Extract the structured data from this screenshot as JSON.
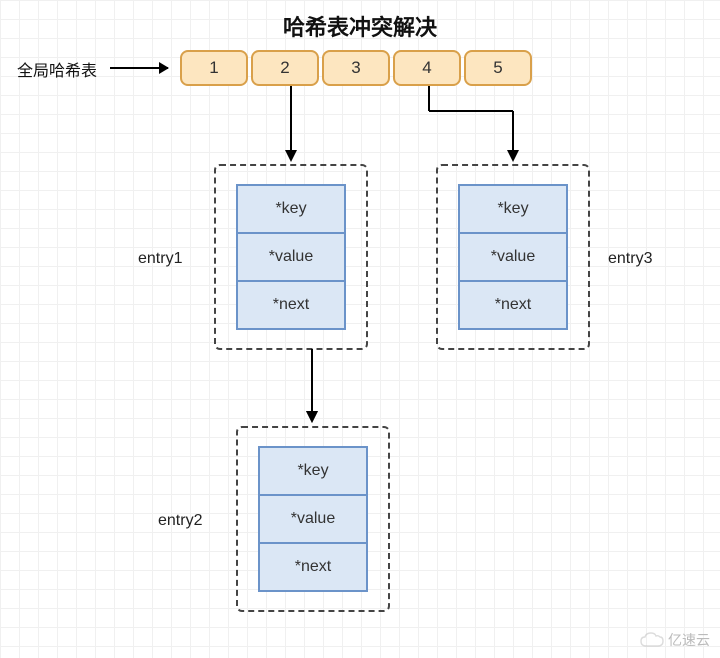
{
  "title": "哈希表冲突解决",
  "labels": {
    "global": "全局哈希表",
    "entry1": "entry1",
    "entry2": "entry2",
    "entry3": "entry3"
  },
  "buckets": [
    "1",
    "2",
    "3",
    "4",
    "5"
  ],
  "entry_fields": {
    "key": "*key",
    "value": "*value",
    "next": "*next"
  },
  "watermark": "亿速云"
}
